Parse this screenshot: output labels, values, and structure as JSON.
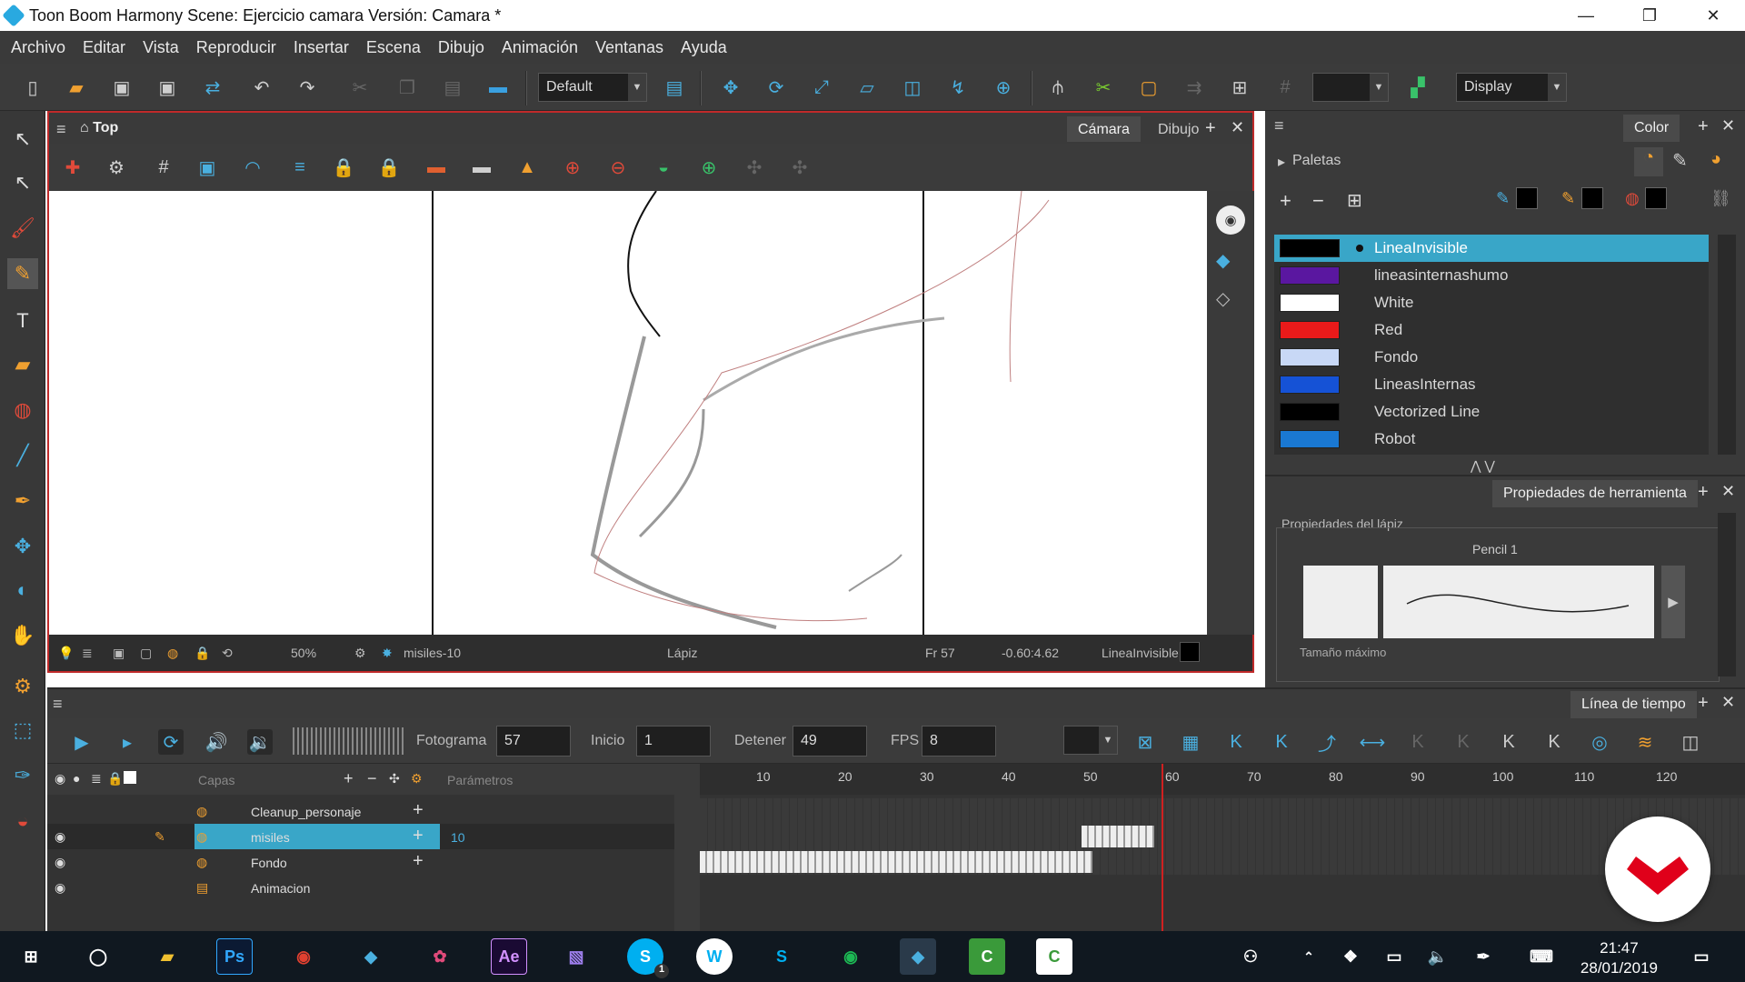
{
  "window": {
    "title": "Toon Boom Harmony Scene: Ejercicio camara Versión: Camara *",
    "min": "—",
    "max": "❐",
    "close": "✕"
  },
  "menu": [
    "Archivo",
    "Editar",
    "Vista",
    "Reproducir",
    "Insertar",
    "Escena",
    "Dibujo",
    "Animación",
    "Ventanas",
    "Ayuda"
  ],
  "toolbar": {
    "workspace": "Default",
    "display": "Display"
  },
  "camera_view": {
    "home_label": "Top",
    "tabs": [
      "Cámara",
      "Dibujo"
    ],
    "status": {
      "zoom": "50%",
      "drawing": "misiles-10",
      "tool": "Lápiz",
      "frame": "Fr 57",
      "coords": "-0.60:4.62",
      "color": "LineaInvisible"
    }
  },
  "color_panel": {
    "tab": "Color",
    "palettes_label": "Paletas",
    "colors": [
      {
        "name": "LineaInvisible",
        "hex": "#000000",
        "selected": true
      },
      {
        "name": "lineasinternashumo",
        "hex": "#5a17a0"
      },
      {
        "name": "White",
        "hex": "#ffffff"
      },
      {
        "name": "Red",
        "hex": "#ea1a1a"
      },
      {
        "name": "Fondo",
        "hex": "#c8d8f6"
      },
      {
        "name": "LineasInternas",
        "hex": "#1552d6"
      },
      {
        "name": "Vectorized Line",
        "hex": "#000000"
      },
      {
        "name": "Robot",
        "hex": "#1a78d2"
      }
    ]
  },
  "tool_properties": {
    "tab": "Propiedades de herramienta",
    "section": "Propiedades del lápiz",
    "preset": "Pencil 1",
    "max_size_label": "Tamaño máximo"
  },
  "timeline": {
    "tab": "Línea de tiempo",
    "frame_label": "Fotograma",
    "frame": "57",
    "start_label": "Inicio",
    "start": "1",
    "stop_label": "Detener",
    "stop": "49",
    "fps_label": "FPS",
    "fps": "8",
    "layers_header": "Capas",
    "params_header": "Parámetros",
    "layers": [
      {
        "name": "Cleanup_personaje",
        "param": ""
      },
      {
        "name": "misiles",
        "param": "10",
        "selected": true
      },
      {
        "name": "Fondo",
        "param": ""
      },
      {
        "name": "Animacion",
        "param": ""
      }
    ],
    "ruler": [
      "10",
      "20",
      "30",
      "40",
      "50",
      "60",
      "70",
      "80",
      "90",
      "100",
      "110",
      "120"
    ]
  },
  "taskbar": {
    "apps": [
      "Ps",
      "Ae",
      "S"
    ],
    "skype_badge": "1",
    "time": "21:47",
    "date": "28/01/2019"
  }
}
